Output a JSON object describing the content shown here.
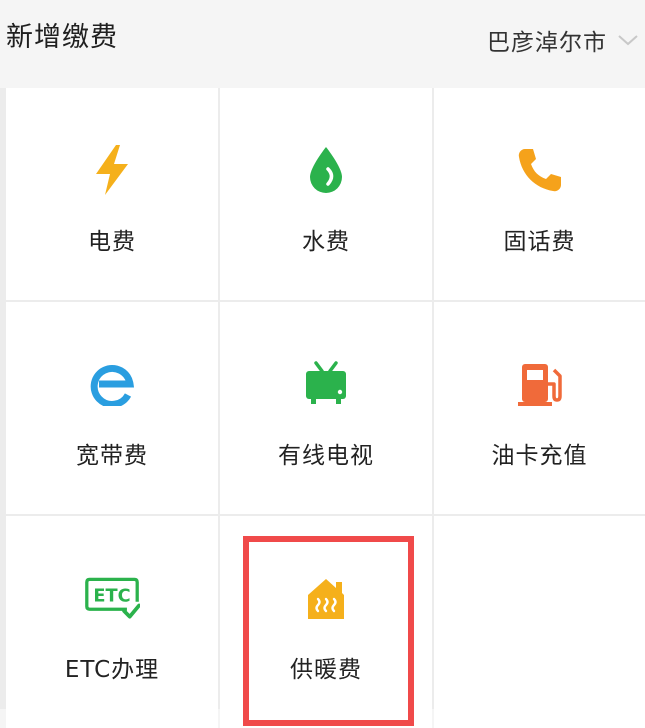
{
  "header": {
    "title": "新增缴费",
    "city": "巴彦淖尔市"
  },
  "services": [
    {
      "label": "电费",
      "icon": "lightning-icon",
      "color": "#f5b01b"
    },
    {
      "label": "水费",
      "icon": "water-drop-icon",
      "color": "#2bb24c"
    },
    {
      "label": "固话费",
      "icon": "phone-icon",
      "color": "#f5a21b"
    },
    {
      "label": "宽带费",
      "icon": "browser-e-icon",
      "color": "#2a9ee0"
    },
    {
      "label": "有线电视",
      "icon": "tv-icon",
      "color": "#2bb24c"
    },
    {
      "label": "油卡充值",
      "icon": "fuel-pump-icon",
      "color": "#f06a3a"
    },
    {
      "label": "ETC办理",
      "icon": "etc-icon",
      "color": "#2bb24c"
    },
    {
      "label": "供暖费",
      "icon": "heating-house-icon",
      "color": "#f5b01b"
    }
  ],
  "colors": {
    "background": "#f5f5f5",
    "highlight": "#f04a4a"
  }
}
